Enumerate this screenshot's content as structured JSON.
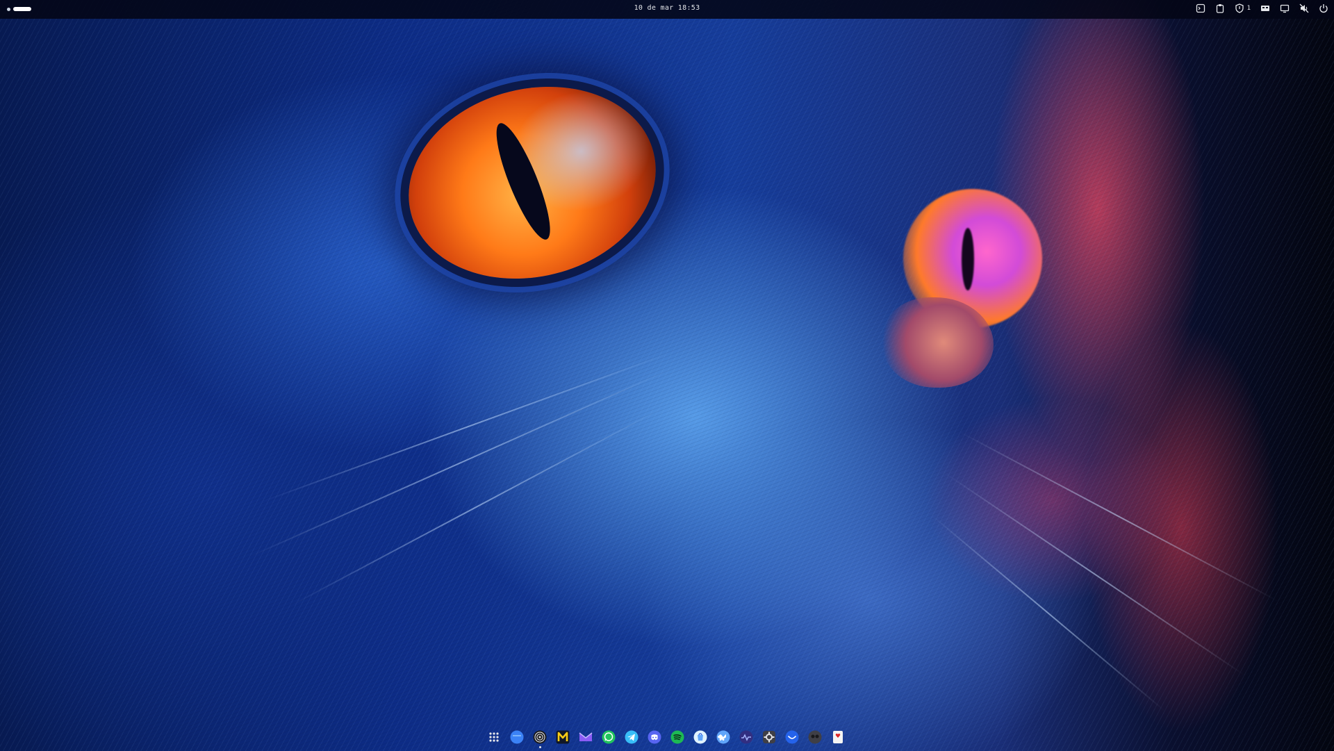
{
  "topbar": {
    "clock": "10 de mar 18:53",
    "tray": {
      "notification_count": "1",
      "icons": [
        "terminal-icon",
        "clipboard-icon",
        "shield-icon",
        "keyboard-layout-icon",
        "display-icon",
        "volume-muted-icon",
        "power-icon"
      ]
    }
  },
  "dock": {
    "items": [
      {
        "icon": "app-grid-icon",
        "color": "#e5e7eb"
      },
      {
        "icon": "files-icon",
        "color": "#3b82f6"
      },
      {
        "icon": "browser-icon",
        "color": "#d4d4d8"
      },
      {
        "icon": "m-app-icon",
        "color": "#facc15"
      },
      {
        "icon": "mail-icon",
        "color": "#8b5cf6"
      },
      {
        "icon": "whatsapp-icon",
        "color": "#22c55e"
      },
      {
        "icon": "telegram-icon",
        "color": "#38bdf8"
      },
      {
        "icon": "discord-icon",
        "color": "#5865f2"
      },
      {
        "icon": "spotify-icon",
        "color": "#1db954"
      },
      {
        "icon": "software-center-icon",
        "color": "#e0f2fe"
      },
      {
        "icon": "bluesky-icon",
        "color": "#60a5fa"
      },
      {
        "icon": "system-monitor-icon",
        "color": "#6366f1"
      },
      {
        "icon": "settings-icon",
        "color": "#a1a1aa"
      },
      {
        "icon": "messenger-icon",
        "color": "#2563eb"
      },
      {
        "icon": "camera-icon",
        "color": "#52525b"
      },
      {
        "icon": "solitaire-icon",
        "color": "#f5f5f4"
      }
    ]
  },
  "colors": {
    "topbar_bg": "#03061699",
    "accent": "#3b82f6"
  }
}
